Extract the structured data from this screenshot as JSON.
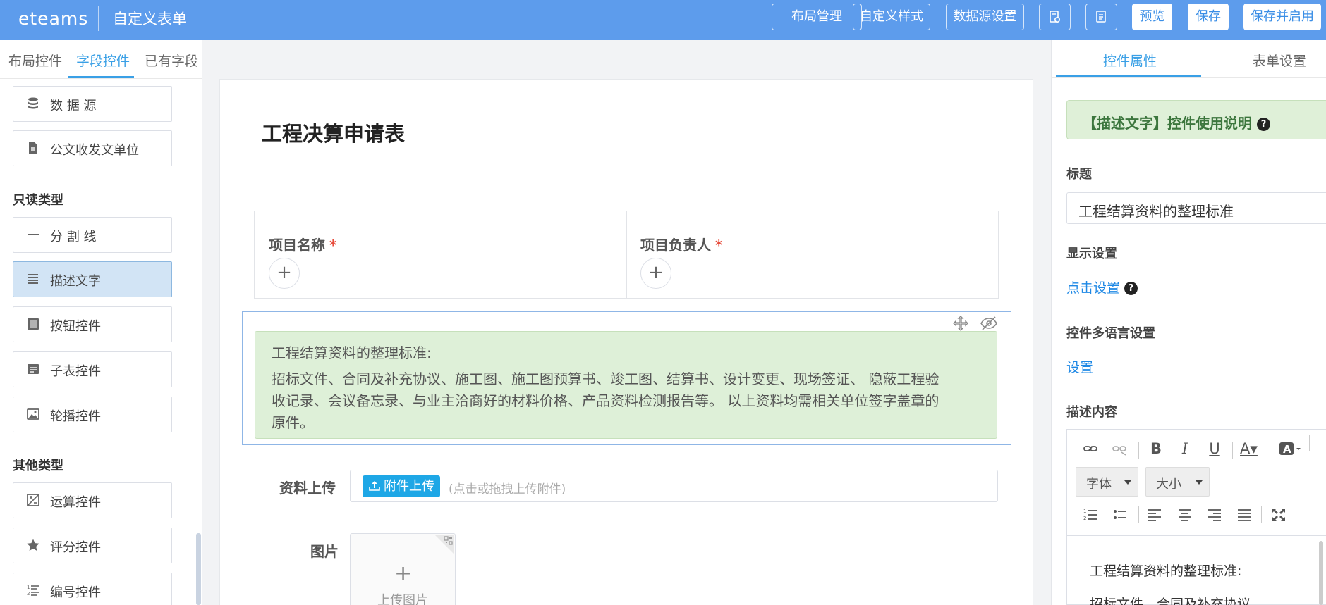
{
  "header": {
    "logo": "eteams",
    "title": "自定义表单",
    "buttons": {
      "layout": "布局管理",
      "custom_style": "自定义样式",
      "datasource": "数据源设置",
      "preview": "预览",
      "save": "保存",
      "save_enable": "保存并启用"
    },
    "icons": [
      "settings-doc-icon",
      "list-doc-icon"
    ]
  },
  "left_panel": {
    "tabs": [
      "布局控件",
      "字段控件",
      "已有字段"
    ],
    "active_tab": "字段控件",
    "items_top": [
      {
        "label": "数 据 源",
        "icon": "database-icon"
      },
      {
        "label": "公文收发文单位",
        "icon": "document-icon"
      }
    ],
    "section_readonly": "只读类型",
    "items_readonly": [
      {
        "label": "分 割 线",
        "icon": "divider-icon"
      },
      {
        "label": "描述文字",
        "icon": "text-lines-icon",
        "selected": true
      },
      {
        "label": "按钮控件",
        "icon": "button-icon"
      },
      {
        "label": "子表控件",
        "icon": "subtable-icon"
      },
      {
        "label": "轮播控件",
        "icon": "carousel-image-icon"
      }
    ],
    "section_other": "其他类型",
    "items_other": [
      {
        "label": "运算控件",
        "icon": "calculation-icon"
      },
      {
        "label": "评分控件",
        "icon": "star-icon"
      },
      {
        "label": "编号控件",
        "icon": "numbered-list-icon"
      }
    ]
  },
  "form": {
    "title": "工程决算申请表",
    "fields": {
      "project_name": "项目名称",
      "project_owner": "项目负责人",
      "required_mark": "*"
    },
    "description": {
      "line1": "工程结算资料的整理标准:",
      "line2": "招标文件、合同及补充协议、施工图、施工图预算书、竣工图、结算书、设计变更、现场签证、 隐蔽工程验",
      "line3": "收记录、会议备忘录、与业主洽商好的材料价格、产品资料检测报告等。 以上资料均需相关单位签字盖章的",
      "line4": "原件。"
    },
    "upload": {
      "label": "资料上传",
      "button": "附件上传",
      "hint": "(点击或拖拽上传附件)"
    },
    "image": {
      "label": "图片",
      "button": "上传图片"
    }
  },
  "right_panel": {
    "tabs": [
      "控件属性",
      "表单设置"
    ],
    "active_tab": "控件属性",
    "help_banner": "【描述文字】控件使用说明",
    "title_label": "标题",
    "title_value": "工程结算资料的整理标准",
    "display_label": "显示设置",
    "display_link": "点击设置",
    "lang_label": "控件多语言设置",
    "lang_link": "设置",
    "content_label": "描述内容",
    "editor": {
      "font_select": "字体",
      "size_select": "大小",
      "text_line1": "工程结算资料的整理标准:",
      "text_line2": "招标文件、合同及补充协议"
    }
  },
  "colors": {
    "header_bg": "#5d9cec",
    "accent": "#3aa0e6",
    "desc_bg": "#def0d8",
    "selected_item_bg": "#d2e4f5",
    "help_text": "#3c763d",
    "required": "#e74c3c"
  }
}
